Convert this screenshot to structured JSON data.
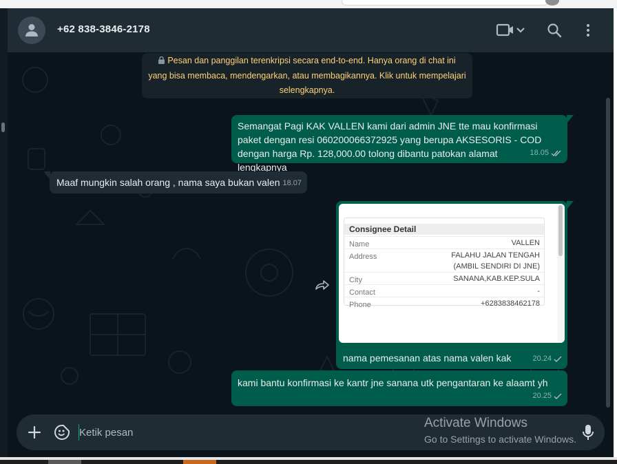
{
  "window": {
    "contact_name": "+62 838-3846-2178"
  },
  "encryption_notice": {
    "line1": "Pesan dan panggilan terenkripsi secara end-to-end. Hanya orang di chat ini",
    "line2": "yang bisa membaca, mendengarkan, atau membagikannya. Klik untuk mempelajari",
    "line3": "selengkapnya."
  },
  "messages": [
    {
      "direction": "out",
      "text": "Semangat Pagi KAK VALLEN kami dari admin JNE tte mau konfirmasi paket dengan resi 060200066372925 yang berupa AKSESORIS - COD dengan harga Rp. 128,000.00 tolong dibantu patokan alamat lengkapnya",
      "time": "18.05"
    },
    {
      "direction": "in",
      "text": "Maaf mungkin salah orang , nama saya bukan valen",
      "time": "18.07"
    },
    {
      "direction": "out",
      "caption": "nama pemesanan atas nama valen kak",
      "time": "20.24"
    },
    {
      "direction": "out",
      "text": "kami bantu konfirmasi ke kantr jne sanana utk pengantaran ke alaamt yh",
      "time": "20.25"
    }
  ],
  "consignee": {
    "title": "Consignee Detail",
    "rows": [
      {
        "key": "Name",
        "value": "VALLEN"
      },
      {
        "key": "Address",
        "value": "FALAHU JALAN TENGAH",
        "value2": "(AMBIL SENDIRI DI JNE)"
      },
      {
        "key": "City",
        "value": "SANANA,KAB.KEP.SULA"
      },
      {
        "key": "Contact",
        "value": "-"
      },
      {
        "key": "Phone",
        "value": "+6283838462178"
      }
    ]
  },
  "composer": {
    "placeholder": "Ketik pesan"
  },
  "watermark": {
    "line1": "Activate Windows",
    "line2": "Go to Settings to activate Windows."
  },
  "colors": {
    "header_bg": "#202c33",
    "chat_bg": "#0b141a",
    "outgoing_bubble": "#005c4b",
    "incoming_bubble": "#202c33",
    "notice_text": "#ffd279",
    "accent": "#00a884"
  }
}
